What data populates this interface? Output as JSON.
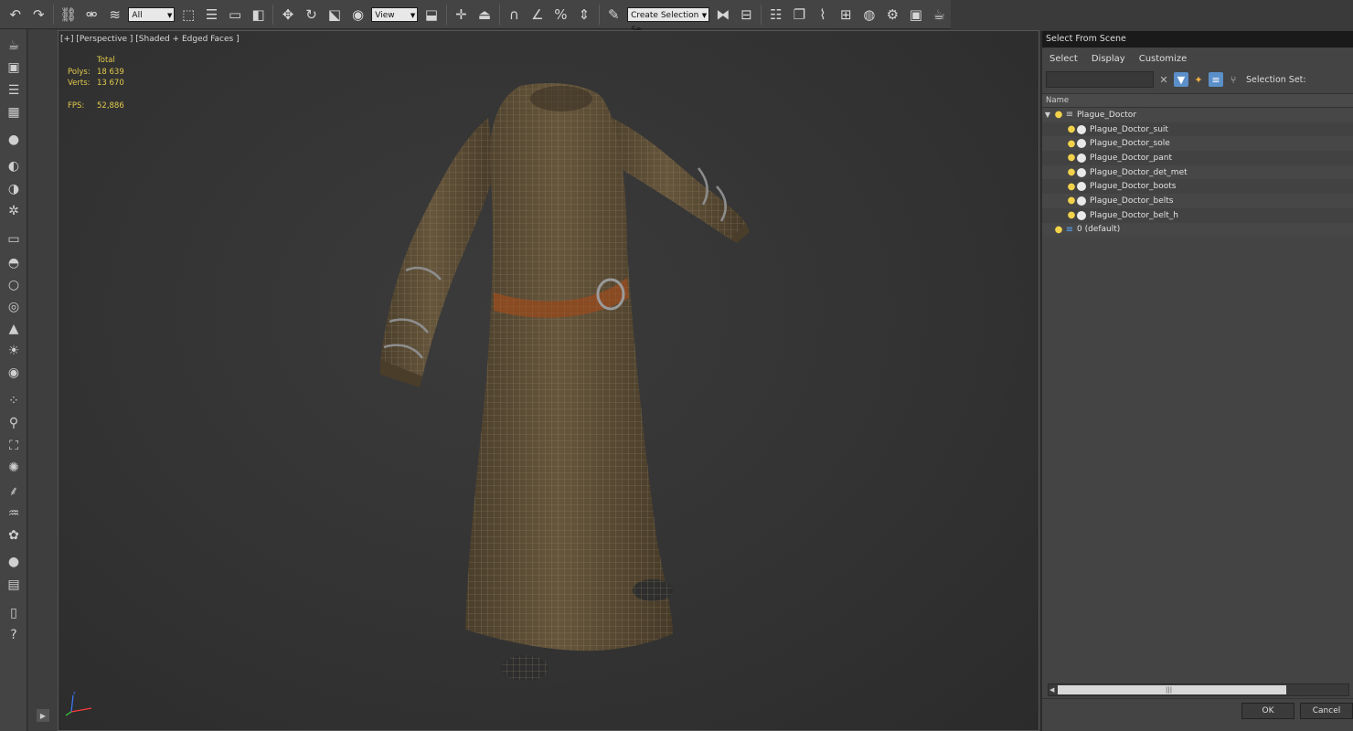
{
  "toolbar": {
    "selection_filter": "All",
    "reference_coord": "View",
    "named_selection": "Create Selection Se"
  },
  "viewport": {
    "label": "[+] [Perspective ] [Shaded + Edged Faces ]",
    "stats": {
      "total_label": "Total",
      "polys_label": "Polys:",
      "polys_value": "18 639",
      "verts_label": "Verts:",
      "verts_value": "13 670",
      "fps_label": "FPS:",
      "fps_value": "52,886"
    }
  },
  "panel": {
    "title": "Select From Scene",
    "menu": [
      "Select",
      "Display",
      "Customize"
    ],
    "selection_set_label": "Selection Set:",
    "column_name": "Name",
    "tree": [
      {
        "label": "Plague_Doctor",
        "level": 0,
        "kind": "layer",
        "expanded": true
      },
      {
        "label": "Plague_Doctor_suit",
        "level": 1,
        "kind": "object"
      },
      {
        "label": "Plague_Doctor_sole",
        "level": 1,
        "kind": "object"
      },
      {
        "label": "Plague_Doctor_pant",
        "level": 1,
        "kind": "object"
      },
      {
        "label": "Plague_Doctor_det_met",
        "level": 1,
        "kind": "object"
      },
      {
        "label": "Plague_Doctor_boots",
        "level": 1,
        "kind": "object"
      },
      {
        "label": "Plague_Doctor_belts",
        "level": 1,
        "kind": "object"
      },
      {
        "label": "Plague_Doctor_belt_h",
        "level": 1,
        "kind": "object"
      },
      {
        "label": "0 (default)",
        "level": 0,
        "kind": "layer-default"
      }
    ],
    "ok_label": "OK",
    "cancel_label": "Cancel"
  },
  "colors": {
    "ui_bg": "#444444",
    "viewport_bg": "#333333",
    "stats_yellow": "#e1c94b",
    "robe_brown": "#5e4f38",
    "belt_orange": "#8a4a22",
    "accent_blue": "#5b8fc9"
  }
}
